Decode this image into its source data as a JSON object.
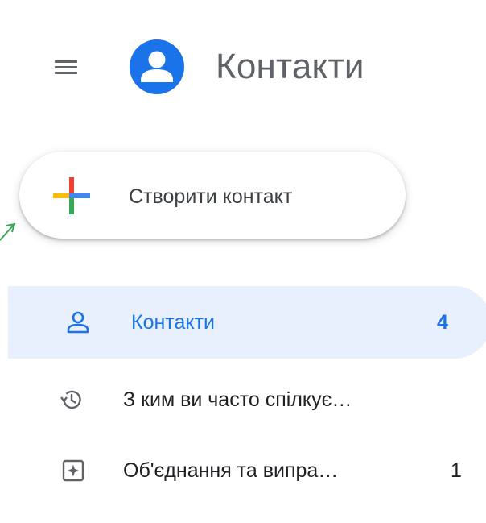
{
  "header": {
    "menu_icon": "hamburger-menu-icon",
    "logo_icon": "contacts-person-logo-icon",
    "title": "Контакти"
  },
  "create": {
    "icon": "colorful-plus-icon",
    "label": "Створити контакт"
  },
  "nav": {
    "items": [
      {
        "icon": "person-outline-icon",
        "label": "Контакти",
        "count": "4",
        "active": true
      },
      {
        "icon": "history-clock-icon",
        "label": "З ким ви часто спілкує…",
        "count": "",
        "active": false
      },
      {
        "icon": "merge-fix-icon",
        "label": "Об'єднання та випра…",
        "count": "1",
        "active": false
      }
    ]
  },
  "colors": {
    "accent_blue": "#1a73e8",
    "active_bg": "#e8f0fe",
    "icon_gray": "#5f6368",
    "plus_blue": "#4285f4",
    "plus_red": "#ea4335",
    "plus_yellow": "#fbbc04",
    "plus_green": "#34a853",
    "edge_arrow_green": "#34a853"
  }
}
